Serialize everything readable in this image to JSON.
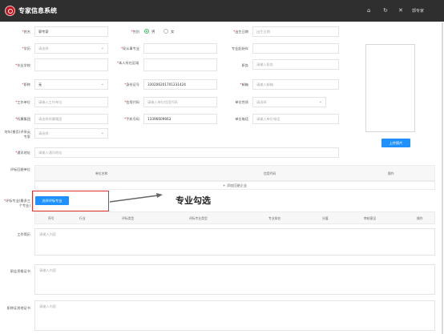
{
  "app": {
    "title": "专家信息系统",
    "user": "郭专家"
  },
  "form": {
    "name": {
      "label": "姓名",
      "value": "郭专家"
    },
    "gender": {
      "label": "性别",
      "options": [
        "男",
        "女"
      ],
      "selected": "男"
    },
    "birthday": {
      "label": "出生日期",
      "placeholder": "出生日期"
    },
    "education": {
      "label": "学历",
      "placeholder": "请选择"
    },
    "current_major": {
      "label": "现从事专业",
      "value": ""
    },
    "major_start": {
      "label": "专业起始年",
      "value": ""
    },
    "school": {
      "label": "毕业学校",
      "value": ""
    },
    "region": {
      "label": "本人所在区域",
      "value": ""
    },
    "position": {
      "label": "职务",
      "placeholder": "请输入职务"
    },
    "title": {
      "label": "职称",
      "value": "无"
    },
    "id_number": {
      "label": "身份证号",
      "value": "330206201701231424"
    },
    "email": {
      "label": "邮箱",
      "placeholder": "请输入邮箱"
    },
    "work_unit": {
      "label": "工作单位",
      "placeholder": "请输入工作单位"
    },
    "credit_code": {
      "label": "信用代码",
      "placeholder": "请输入单位信用代码"
    },
    "unit_nature": {
      "label": "单位性质",
      "placeholder": "请选择"
    },
    "affiliation": {
      "label": "所属集团",
      "placeholder": "请选择所属集团"
    },
    "phone": {
      "label": "手机号码",
      "value": "13396609663"
    },
    "unit_phone": {
      "label": "单位电话",
      "placeholder": "请输入单位电话"
    },
    "procurement": {
      "label": "何年(曾否)评采云专家",
      "placeholder": "请选择"
    },
    "address": {
      "label": "通讯地址",
      "placeholder": "请输入通讯地址"
    },
    "upload_button": "上传照片"
  },
  "units_table": {
    "label": "评标回避单位",
    "headers": [
      "单位名称",
      "信用代码",
      "操作"
    ],
    "add_text": "+ 添加回避企业"
  },
  "majors": {
    "label": "评标专业(最多三个专业)",
    "select_button": "选择评标专业",
    "headers": [
      "序号",
      "行业",
      "评标类型",
      "评标专业类型",
      "专业排名",
      "分值",
      "审核意见",
      "操作"
    ]
  },
  "annotation": {
    "text": "专业勾选"
  },
  "textareas": [
    {
      "label": "工作简历",
      "placeholder": "请输入内容"
    },
    {
      "label": "职业资格证书",
      "placeholder": "请输入内容"
    },
    {
      "label": "职称证其他证书",
      "placeholder": "请输入内容"
    }
  ],
  "colors": {
    "topbar": "#2f2f2f",
    "accent": "#1e90ff",
    "highlight": "#e0302a",
    "radio_on": "#43c26b"
  },
  "icons": [
    "home-icon",
    "refresh-icon",
    "close-icon"
  ]
}
